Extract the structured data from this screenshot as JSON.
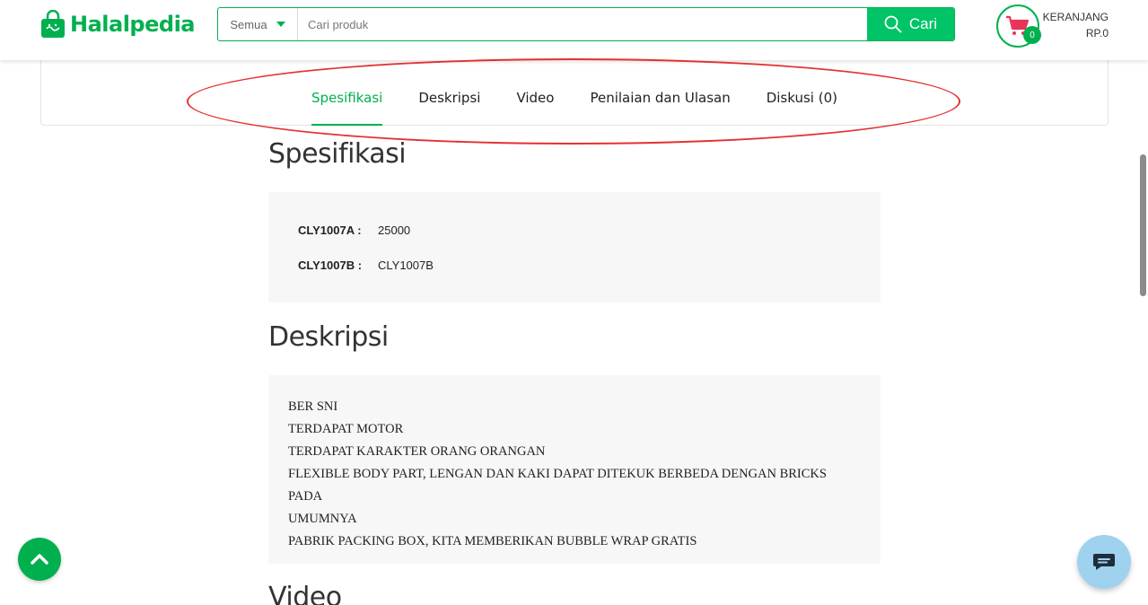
{
  "header": {
    "logo_text": "Halalpedia",
    "search": {
      "category": "Semua",
      "placeholder": "Cari produk",
      "button_label": "Cari"
    },
    "cart": {
      "count": "0",
      "label": "KERANJANG",
      "total": "RP.0"
    }
  },
  "tabs": [
    {
      "label": "Spesifikasi",
      "active": true
    },
    {
      "label": "Deskripsi",
      "active": false
    },
    {
      "label": "Video",
      "active": false
    },
    {
      "label": "Penilaian dan Ulasan",
      "active": false
    },
    {
      "label": "Diskusi (0)",
      "active": false
    }
  ],
  "spesifikasi": {
    "title": "Spesifikasi",
    "rows": [
      {
        "key": "CLY1007A :",
        "value": "25000"
      },
      {
        "key": "CLY1007B :",
        "value": "CLY1007B"
      }
    ]
  },
  "deskripsi": {
    "title": "Deskripsi",
    "lines": [
      "BER SNI",
      "TERDAPAT MOTOR",
      "TERDAPAT KARAKTER ORANG ORANGAN",
      "FLEXIBLE BODY PART, LENGAN DAN KAKI DAPAT DITEKUK BERBEDA DENGAN BRICKS PADA",
      "UMUMNYA",
      "PABRIK PACKING BOX, KITA MEMBERIKAN BUBBLE WRAP GRATIS"
    ]
  },
  "video": {
    "title": "Video"
  },
  "colors": {
    "brand_green": "#00b04f",
    "search_button": "#00c466",
    "annotation_red": "#e53030",
    "chat_button": "#9fd2ee"
  },
  "icons": [
    "shopping-bag-logo-icon",
    "search-icon",
    "cart-icon",
    "chevron-up-icon",
    "chat-icon"
  ]
}
